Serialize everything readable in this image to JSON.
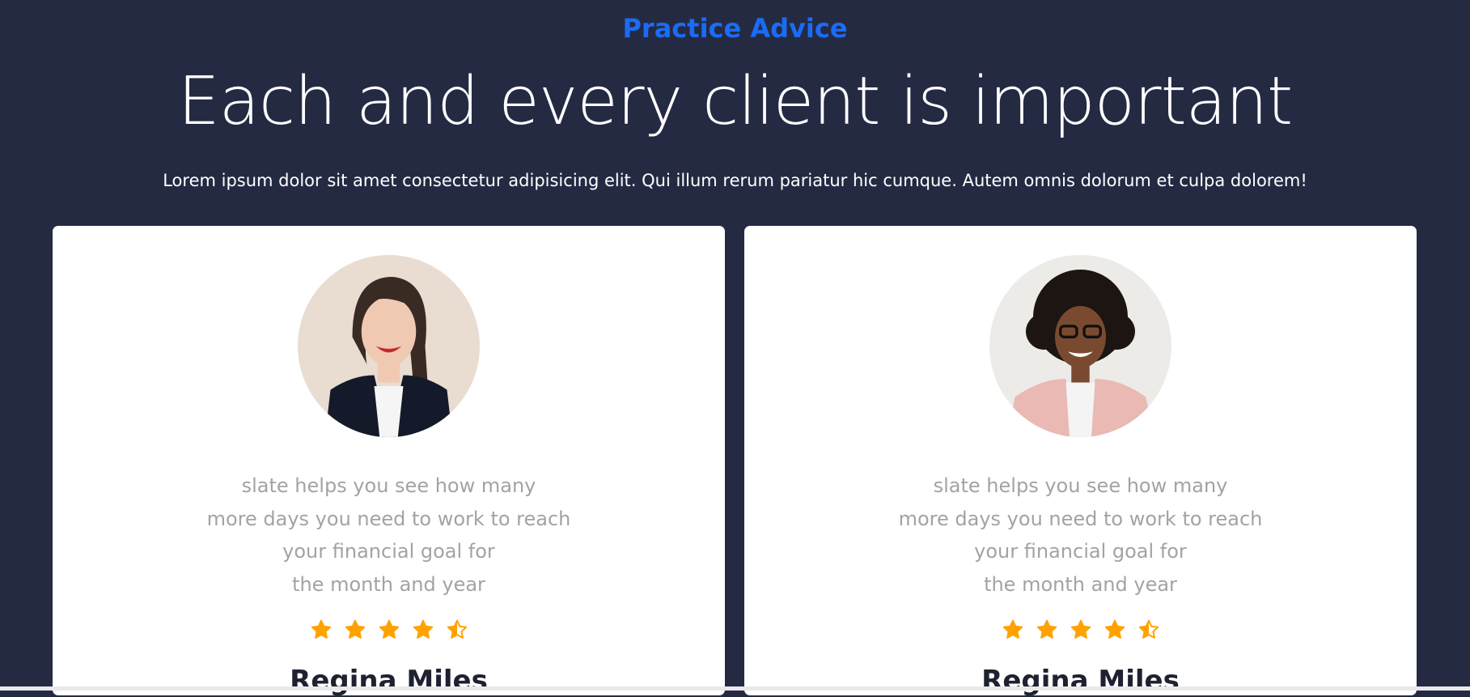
{
  "header": {
    "eyebrow": "Practice Advice",
    "title": "Each and every client is important",
    "lead": "Lorem ipsum dolor sit amet consectetur adipisicing elit. Qui illum rerum pariatur hic cumque. Autem omnis dolorum et culpa dolorem!"
  },
  "colors": {
    "background": "#252a43",
    "accent": "#1a6cf5",
    "star": "#ffa200",
    "quote": "#a3a3a3"
  },
  "testimonials": [
    {
      "quote_lines": [
        "slate helps you see how many",
        "more days you need to work to reach",
        "your financial goal for",
        "the month and year"
      ],
      "rating": 4.5,
      "name": "Regina Miles",
      "avatar_icon": "avatar-woman-dark-hair"
    },
    {
      "quote_lines": [
        "slate helps you see how many",
        "more days you need to work to reach",
        "your financial goal for",
        "the month and year"
      ],
      "rating": 4.5,
      "name": "Regina Miles",
      "avatar_icon": "avatar-woman-curly-hair"
    }
  ]
}
